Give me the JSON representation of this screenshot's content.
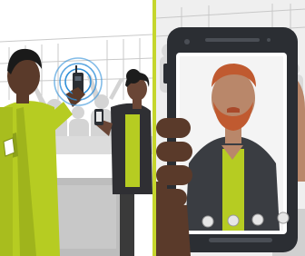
{
  "scene": {
    "left_panel": {
      "subject": "crowd-at-event",
      "people": [
        "officer-with-radio",
        "woman-recording-on-phone"
      ],
      "radio_signal": "active"
    },
    "right_panel": {
      "subject": "hand-holding-smartphone",
      "screen_content": "video-call-with-bearded-man",
      "call_controls": 4
    },
    "colors": {
      "accent_lime": "#b6cc22",
      "divider": "#c5d62c",
      "signal_blue": "#2f8fd8",
      "skin_dark": "#5a3a2a",
      "skin_light": "#b9876a",
      "hair_beard": "#c05a30",
      "phone_body": "#2b2e33",
      "background_gray": "#d9d9d9"
    }
  }
}
